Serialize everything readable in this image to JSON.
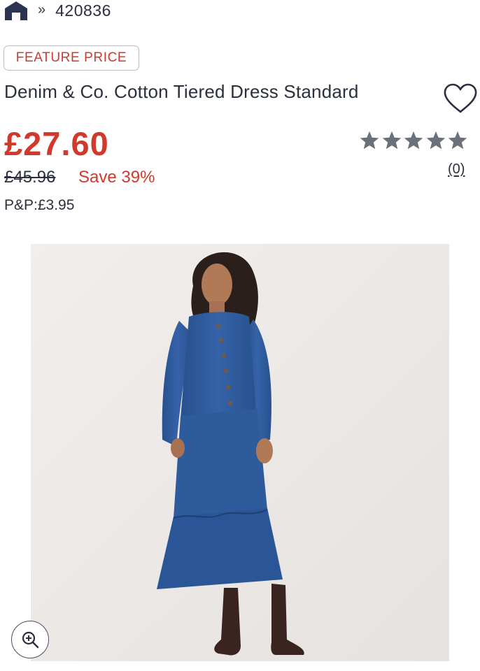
{
  "breadcrumb": {
    "home_icon": "home-icon",
    "separator": "»",
    "item_id": "420836"
  },
  "product": {
    "badge": "FEATURE PRICE",
    "title": "Denim & Co. Cotton Tiered Dress Standard",
    "price": "£27.60",
    "was_price": "£45.96",
    "save_text": "Save 39%",
    "pnp": "P&P:£3.95"
  },
  "rating": {
    "stars": 5,
    "filled": 5,
    "review_count": "(0)"
  },
  "colors": {
    "accent_red": "#d0392b",
    "text_dark": "#2b2f3f",
    "star_gray": "#6b707c",
    "denim_blue": "#2f5a9a"
  },
  "icons": {
    "wishlist": "heart-icon",
    "zoom": "zoom-in-icon",
    "star": "star-icon"
  }
}
